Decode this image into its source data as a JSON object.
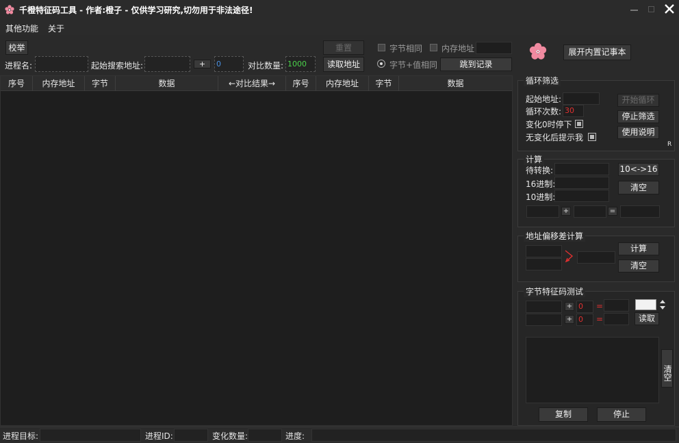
{
  "window": {
    "title": "千橙特征码工具 - 作者:橙子 - 仅供学习研究,切勿用于非法途径!"
  },
  "menu": {
    "items": [
      {
        "label": "其他功能"
      },
      {
        "label": "关于"
      }
    ]
  },
  "toolbar": {
    "enum_label": "校举",
    "process_label": "进程名:",
    "start_addr_label": "起始搜索地址:",
    "plus_label": "+",
    "offset_value": "0",
    "compare_count_label": "对比数量:",
    "compare_count_value": "1000",
    "reset_label": "重置",
    "read_addr_label": "读取地址",
    "byte_same_label": "字节相同",
    "mem_addr_label": "内存地址",
    "byte_value_same_label": "字节+值相同",
    "jump_label": "跳到记录"
  },
  "table": {
    "columns": [
      "序号",
      "内存地址",
      "字节",
      "数据",
      "←对比结果→",
      "序号",
      "内存地址",
      "字节",
      "数据"
    ]
  },
  "right": {
    "notepad_label": "展开内置记事本",
    "loop": {
      "title": "循环筛选",
      "start_addr_label": "起始地址:",
      "count_label": "循环次数:",
      "count_value": "30",
      "stop_zero_label": "变化0时停下",
      "notify_label": "无变化后提示我",
      "start_btn": "开始循环",
      "stop_btn": "停止筛选",
      "help_btn": "使用说明",
      "r_label": "R"
    },
    "calc": {
      "title": "计算",
      "to_convert_label": "待转换:",
      "hex_label": "16进制:",
      "dec_label": "10进制:",
      "convert_btn": "10<->16",
      "clear_btn": "清空",
      "plus_label": "+",
      "equals_label": "="
    },
    "offset": {
      "title": "地址偏移差计算",
      "calc_btn": "计算",
      "clear_btn": "清空"
    },
    "bytetest": {
      "title": "字节特征码测试",
      "plus_label": "+",
      "value1": "0",
      "value2": "0",
      "equals_label": "=",
      "read_btn": "读取",
      "clear_btn": "清空",
      "copy_btn": "复制",
      "stop_btn": "停止"
    }
  },
  "status": {
    "target_label": "进程目标:",
    "pid_label": "进程ID:",
    "change_label": "变化数量:",
    "progress_label": "进度:"
  },
  "colors": {
    "accent_red": "#e03030",
    "accent_green": "#4bd24b",
    "accent_blue": "#4a90e2",
    "logo_pink": "#f08aa0"
  }
}
